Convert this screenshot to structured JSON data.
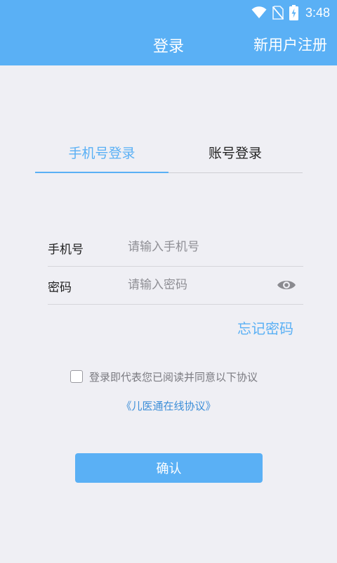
{
  "status_bar": {
    "time": "3:48",
    "icons": [
      "wifi-icon",
      "no-sim-icon",
      "battery-charging-icon"
    ]
  },
  "header": {
    "title": "登录",
    "register_label": "新用户注册"
  },
  "tabs": [
    {
      "label": "手机号登录",
      "active": true
    },
    {
      "label": "账号登录",
      "active": false
    }
  ],
  "form": {
    "phone": {
      "label": "手机号",
      "placeholder": "请输入手机号",
      "value": ""
    },
    "password": {
      "label": "密码",
      "placeholder": "请输入密码",
      "value": "",
      "toggle_icon": "eye-icon"
    }
  },
  "forgot_password": "忘记密码",
  "agreement": {
    "checked": false,
    "text": "登录即代表您已阅读并同意以下协议",
    "link": "《儿医通在线协议》"
  },
  "confirm_label": "确认",
  "colors": {
    "primary": "#5ab0f5",
    "background": "#efeff4",
    "link": "#3c8ed8"
  }
}
